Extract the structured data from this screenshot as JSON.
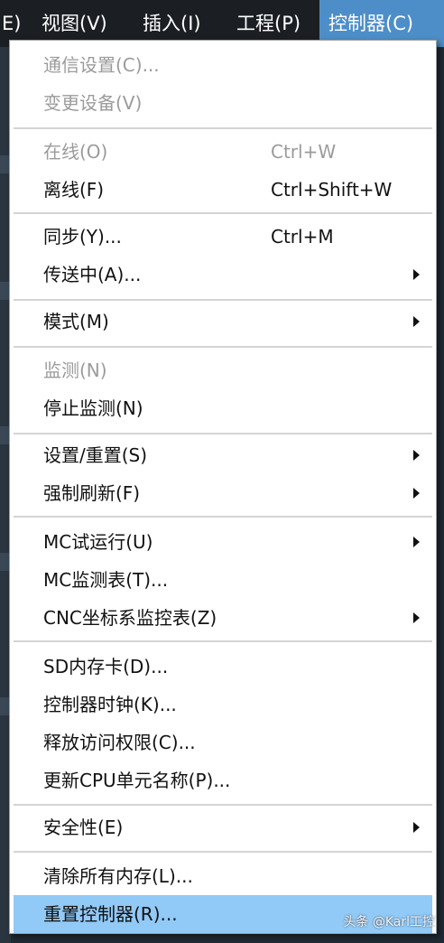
{
  "menubar": {
    "items": [
      {
        "label": "E)"
      },
      {
        "label": "视图(V)"
      },
      {
        "label": "插入(I)"
      },
      {
        "label": "工程(P)"
      },
      {
        "label": "控制器(C)"
      }
    ]
  },
  "menu": {
    "items": [
      {
        "label": "通信设置(C)...",
        "shortcut": "",
        "disabled": true
      },
      {
        "label": "变更设备(V)",
        "shortcut": "",
        "disabled": true
      },
      {
        "label": "在线(O)",
        "shortcut": "Ctrl+W",
        "disabled": true
      },
      {
        "label": "离线(F)",
        "shortcut": "Ctrl+Shift+W",
        "disabled": false
      },
      {
        "label": "同步(Y)...",
        "shortcut": "Ctrl+M",
        "disabled": false
      },
      {
        "label": "传送中(A)...",
        "shortcut": "",
        "disabled": false,
        "submenu": true
      },
      {
        "label": "模式(M)",
        "shortcut": "",
        "disabled": false,
        "submenu": true
      },
      {
        "label": "监测(N)",
        "shortcut": "",
        "disabled": true
      },
      {
        "label": "停止监测(N)",
        "shortcut": "",
        "disabled": false
      },
      {
        "label": "设置/重置(S)",
        "shortcut": "",
        "disabled": false,
        "submenu": true
      },
      {
        "label": "强制刷新(F)",
        "shortcut": "",
        "disabled": false,
        "submenu": true
      },
      {
        "label": "MC试运行(U)",
        "shortcut": "",
        "disabled": false,
        "submenu": true
      },
      {
        "label": "MC监测表(T)...",
        "shortcut": "",
        "disabled": false
      },
      {
        "label": "CNC坐标系监控表(Z)",
        "shortcut": "",
        "disabled": false,
        "submenu": true
      },
      {
        "label": "SD内存卡(D)...",
        "shortcut": "",
        "disabled": false
      },
      {
        "label": "控制器时钟(K)...",
        "shortcut": "",
        "disabled": false
      },
      {
        "label": "释放访问权限(C)...",
        "shortcut": "",
        "disabled": false
      },
      {
        "label": "更新CPU单元名称(P)...",
        "shortcut": "",
        "disabled": false
      },
      {
        "label": "安全性(E)",
        "shortcut": "",
        "disabled": false,
        "submenu": true
      },
      {
        "label": "清除所有内存(L)...",
        "shortcut": "",
        "disabled": false
      },
      {
        "label": "重置控制器(R)...",
        "shortcut": "",
        "disabled": false,
        "selected": true
      }
    ]
  },
  "watermark": "头条 @Karl工控",
  "colors": {
    "menubar_bg": "#1b1f23",
    "active_menu": "#4d8ec8",
    "selected_item": "#91c9f7",
    "disabled_text": "#9b9b9b"
  }
}
